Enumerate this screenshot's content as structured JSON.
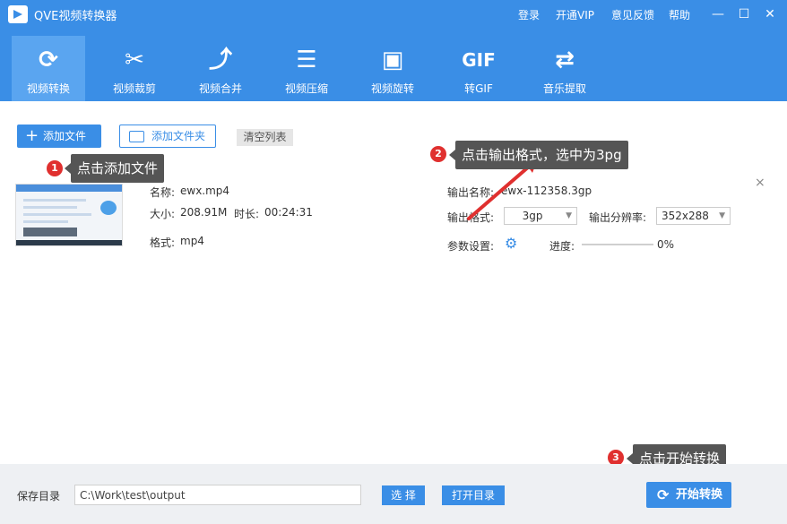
{
  "app": {
    "title": "QVE视频转换器"
  },
  "topbar": {
    "links": [
      "登录",
      "开通VIP",
      "意见反馈",
      "帮助"
    ],
    "window": {
      "minimize": "—",
      "maximize": "☐",
      "close": "✕"
    }
  },
  "toolbar": {
    "items": [
      {
        "label": "视频转换",
        "icon": "refresh-icon",
        "glyph": "⟳",
        "active": true
      },
      {
        "label": "视频裁剪",
        "icon": "scissors-icon",
        "glyph": "✂",
        "active": false
      },
      {
        "label": "视频合并",
        "icon": "merge-icon",
        "glyph": "⤴",
        "active": false
      },
      {
        "label": "视频压缩",
        "icon": "compress-icon",
        "glyph": "☰",
        "active": false
      },
      {
        "label": "视频旋转",
        "icon": "rotate-icon",
        "glyph": "▣",
        "active": false
      },
      {
        "label": "转GIF",
        "icon": "gif-icon",
        "glyph": "GIF",
        "active": false
      },
      {
        "label": "音乐提取",
        "icon": "shuffle-icon",
        "glyph": "⇄",
        "active": false
      }
    ]
  },
  "actions": {
    "add_file": "添加文件",
    "add_folder": "添加文件夹",
    "clear_list": "清空列表"
  },
  "file": {
    "name_label": "名称:",
    "name": "ewx.mp4",
    "size_label": "大小:",
    "size": "208.91M",
    "duration_label": "时长:",
    "duration": "00:24:31",
    "format_label": "格式:",
    "format": "mp4",
    "output_name_label": "输出名称:",
    "output_name": "ewx-112358.3gp",
    "output_format_label": "输出格式:",
    "output_format": "3gp",
    "output_resolution_label": "输出分辨率:",
    "output_resolution": "352x288",
    "params_label": "参数设置:",
    "progress_label": "进度:",
    "progress": "0%",
    "remove": "×"
  },
  "callouts": [
    {
      "num": "1",
      "text": "点击添加文件"
    },
    {
      "num": "2",
      "text": "点击输出格式，选中为3pg"
    },
    {
      "num": "3",
      "text": "点击开始转换"
    }
  ],
  "bottom": {
    "save_label": "保存目录",
    "path": "C:\\Work\\test\\output",
    "select": "选 择",
    "open_dir": "打开目录",
    "start": "开始转换"
  },
  "colors": {
    "primary": "#3a8ee6",
    "callout_badge": "#e0302f",
    "callout_bg": "#555555",
    "arrow": "#e0302f"
  }
}
